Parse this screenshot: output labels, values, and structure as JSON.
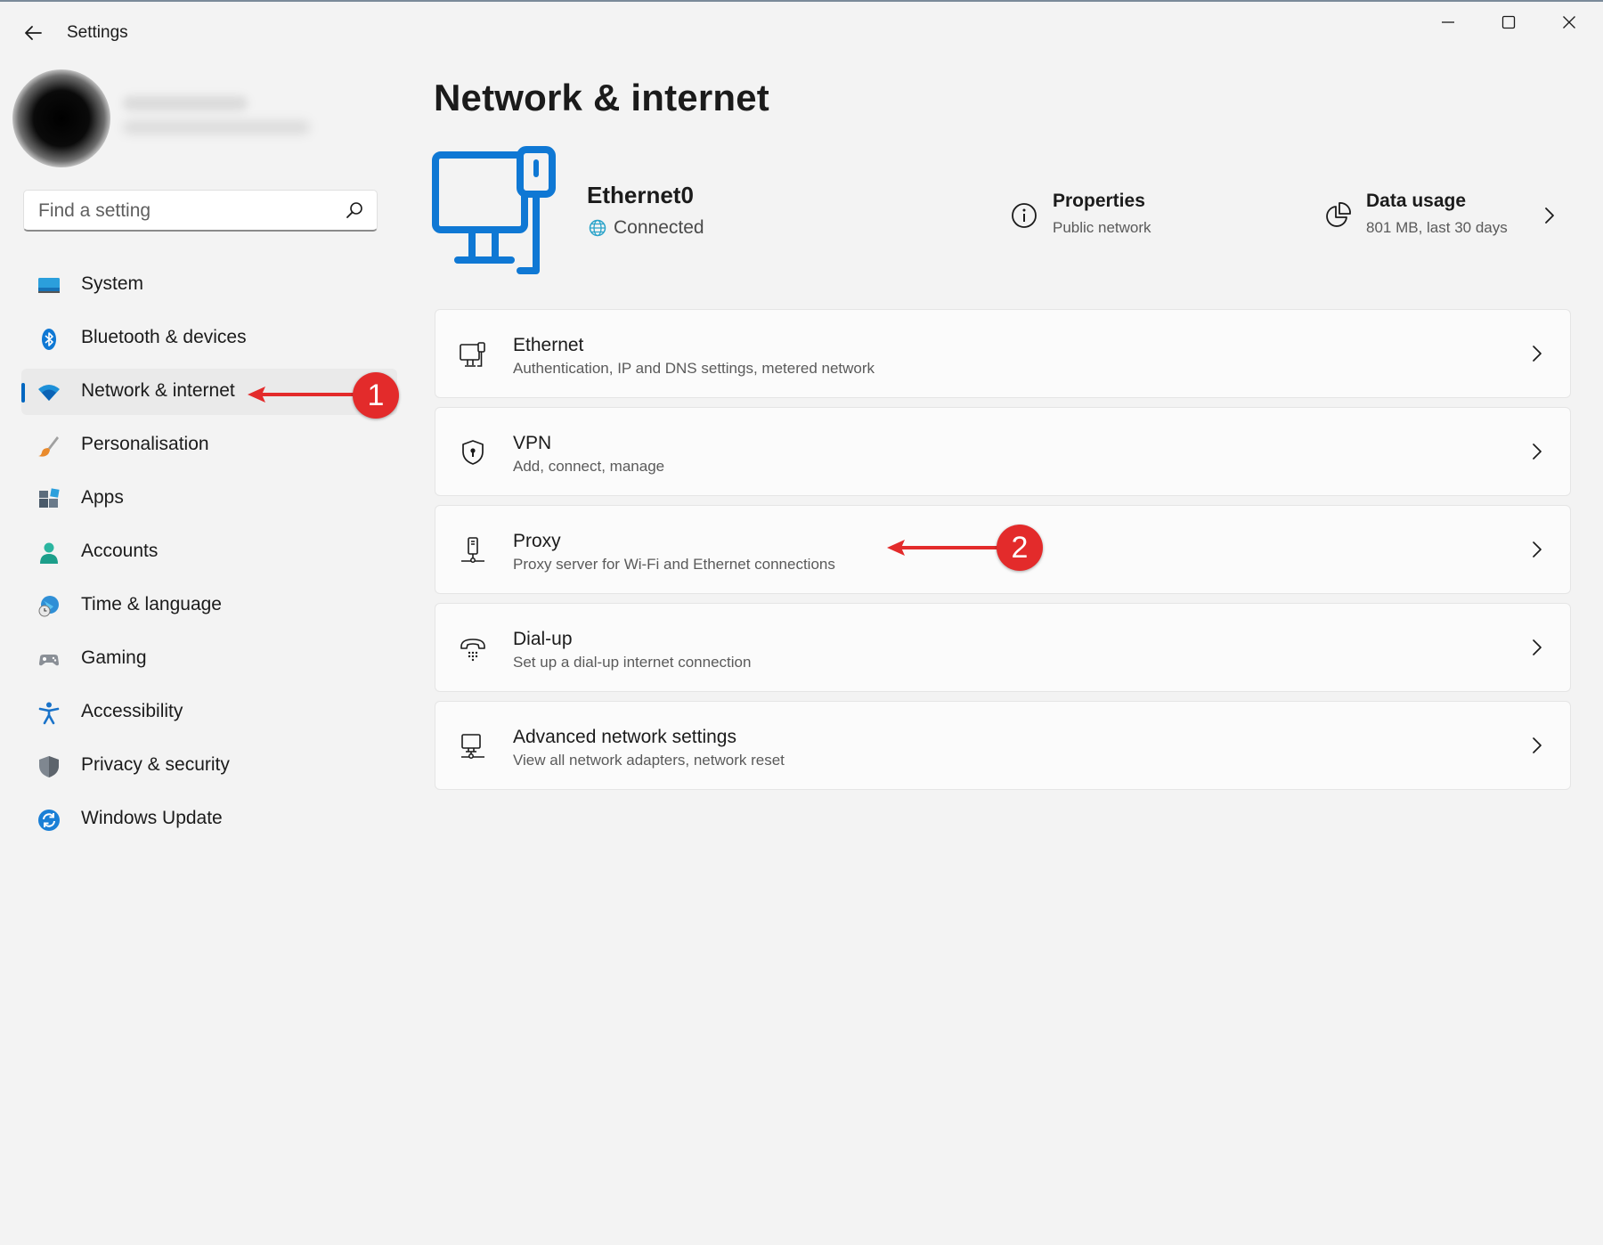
{
  "window": {
    "title": "Settings",
    "controls": {
      "minimize_icon": "minimize-icon",
      "maximize_icon": "maximize-icon",
      "close_icon": "close-icon"
    }
  },
  "search": {
    "placeholder": "Find a setting",
    "value": ""
  },
  "sidebar": {
    "items": [
      {
        "label": "System",
        "icon": "system-icon",
        "active": false
      },
      {
        "label": "Bluetooth & devices",
        "icon": "bluetooth-icon",
        "active": false
      },
      {
        "label": "Network & internet",
        "icon": "wifi-icon",
        "active": true
      },
      {
        "label": "Personalisation",
        "icon": "brush-icon",
        "active": false
      },
      {
        "label": "Apps",
        "icon": "apps-icon",
        "active": false
      },
      {
        "label": "Accounts",
        "icon": "person-icon",
        "active": false
      },
      {
        "label": "Time & language",
        "icon": "globe-clock-icon",
        "active": false
      },
      {
        "label": "Gaming",
        "icon": "gamepad-icon",
        "active": false
      },
      {
        "label": "Accessibility",
        "icon": "accessibility-icon",
        "active": false
      },
      {
        "label": "Privacy & security",
        "icon": "shield-icon",
        "active": false
      },
      {
        "label": "Windows Update",
        "icon": "update-icon",
        "active": false
      }
    ]
  },
  "main": {
    "title": "Network & internet",
    "adapter": {
      "name": "Ethernet0",
      "status": "Connected"
    },
    "properties": {
      "title": "Properties",
      "subtitle": "Public network"
    },
    "data_usage": {
      "title": "Data usage",
      "subtitle": "801 MB, last 30 days"
    },
    "cards": [
      {
        "title": "Ethernet",
        "subtitle": "Authentication, IP and DNS settings, metered network",
        "icon": "ethernet-icon"
      },
      {
        "title": "VPN",
        "subtitle": "Add, connect, manage",
        "icon": "vpn-shield-icon"
      },
      {
        "title": "Proxy",
        "subtitle": "Proxy server for Wi-Fi and Ethernet connections",
        "icon": "proxy-icon"
      },
      {
        "title": "Dial-up",
        "subtitle": "Set up a dial-up internet connection",
        "icon": "phone-icon"
      },
      {
        "title": "Advanced network settings",
        "subtitle": "View all network adapters, network reset",
        "icon": "network-adapter-icon"
      }
    ]
  },
  "annotations": [
    {
      "number": "1",
      "color": "#e32b2b"
    },
    {
      "number": "2",
      "color": "#e32b2b"
    }
  ],
  "colors": {
    "accent": "#0067c0",
    "background": "#f3f3f3",
    "card": "#fbfbfb",
    "annotation": "#e32b2b"
  }
}
